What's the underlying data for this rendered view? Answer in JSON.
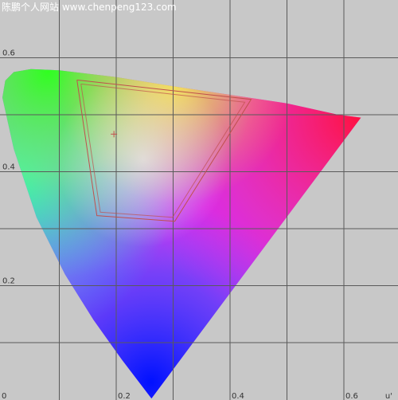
{
  "watermark": "陈鹏个人网站   www.chenpeng123.com",
  "colors": {
    "background": "#c8c8c8",
    "grid": "#5a5a5a",
    "outline": "#c0504d",
    "white_point": "#c0504d"
  },
  "chart_data": {
    "type": "scatter",
    "title": "",
    "xlabel": "u'",
    "ylabel": "",
    "xlim": [
      0.0,
      0.7
    ],
    "ylim": [
      0.0,
      0.7
    ],
    "x_ticks": [
      {
        "value": 0.0,
        "label": "0"
      },
      {
        "value": 0.2,
        "label": "0.2"
      },
      {
        "value": 0.4,
        "label": "0.4"
      },
      {
        "value": 0.6,
        "label": "0.6"
      }
    ],
    "y_ticks": [
      {
        "value": 0.2,
        "label": "0.2"
      },
      {
        "value": 0.4,
        "label": "0.4"
      },
      {
        "value": 0.6,
        "label": "0.6"
      }
    ],
    "grid_lines": [
      0.1,
      0.2,
      0.3,
      0.4,
      0.5,
      0.6
    ],
    "grid": true,
    "spectral_locus": [
      [
        0.262,
        0.002
      ],
      [
        0.21,
        0.07
      ],
      [
        0.16,
        0.14
      ],
      [
        0.11,
        0.22
      ],
      [
        0.06,
        0.32
      ],
      [
        0.02,
        0.44
      ],
      [
        0.0,
        0.53
      ],
      [
        0.005,
        0.56
      ],
      [
        0.02,
        0.575
      ],
      [
        0.05,
        0.58
      ],
      [
        0.1,
        0.578
      ],
      [
        0.2,
        0.566
      ],
      [
        0.3,
        0.55
      ],
      [
        0.4,
        0.535
      ],
      [
        0.5,
        0.52
      ],
      [
        0.59,
        0.5
      ],
      [
        0.63,
        0.495
      ]
    ],
    "gamut_outline": [
      [
        0.131,
        0.561
      ],
      [
        0.166,
        0.323
      ],
      [
        0.303,
        0.313
      ],
      [
        0.437,
        0.527
      ],
      [
        0.131,
        0.561
      ]
    ],
    "gamut_outline_inner": [
      [
        0.138,
        0.554
      ],
      [
        0.172,
        0.329
      ],
      [
        0.299,
        0.32
      ],
      [
        0.426,
        0.522
      ],
      [
        0.138,
        0.554
      ]
    ],
    "white_point": [
      0.196,
      0.466
    ]
  }
}
